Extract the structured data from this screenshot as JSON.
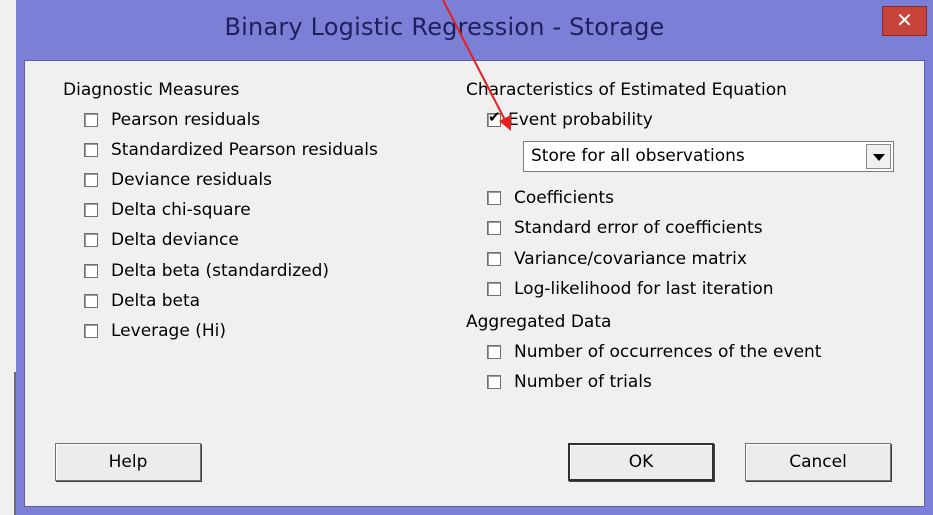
{
  "window": {
    "title": "Binary Logistic Regression - Storage",
    "close_glyph": "✕"
  },
  "diagnostic": {
    "heading": "Diagnostic Measures",
    "items": [
      {
        "label": "Pearson residuals",
        "checked": false
      },
      {
        "label": "Standardized Pearson residuals",
        "checked": false
      },
      {
        "label": "Deviance residuals",
        "checked": false
      },
      {
        "label": "Delta chi-square",
        "checked": false
      },
      {
        "label": "Delta deviance",
        "checked": false
      },
      {
        "label": "Delta beta (standardized)",
        "checked": false
      },
      {
        "label": "Delta beta",
        "checked": false
      },
      {
        "label": "Leverage (Hi)",
        "checked": false
      }
    ]
  },
  "characteristics": {
    "heading": "Characteristics of Estimated Equation",
    "event_probability": {
      "label": "Event probability",
      "checked": true
    },
    "store_select": {
      "value": "Store for all observations"
    },
    "items": [
      {
        "label": "Coefficients",
        "checked": false
      },
      {
        "label": "Standard error of coefficients",
        "checked": false
      },
      {
        "label": "Variance/covariance matrix",
        "checked": false
      },
      {
        "label": "Log-likelihood for last iteration",
        "checked": false
      }
    ]
  },
  "aggregated": {
    "heading": "Aggregated Data",
    "items": [
      {
        "label": "Number of occurrences of the event",
        "checked": false
      },
      {
        "label": "Number of trials",
        "checked": false
      }
    ]
  },
  "buttons": {
    "help": "Help",
    "ok": "OK",
    "cancel": "Cancel"
  },
  "colors": {
    "frame": "#7b7fd6",
    "close": "#c6443a",
    "annotation_arrow": "#e8201c"
  }
}
